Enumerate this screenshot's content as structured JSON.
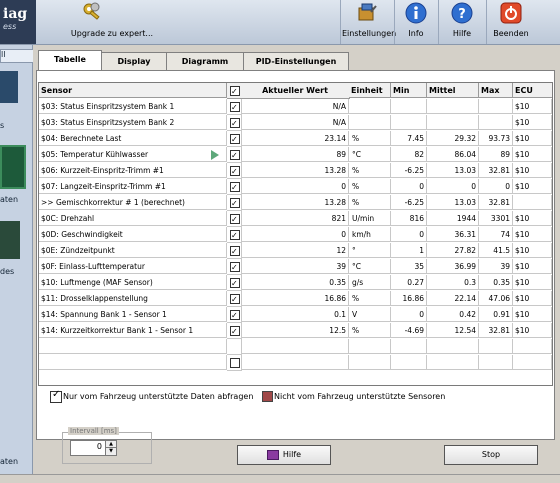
{
  "brand": {
    "title": "iag",
    "subtitle": "ess"
  },
  "toolbar": {
    "upgrade_label": "Upgrade zu expert...",
    "settings_label": "Einstellungen",
    "info_label": "Info",
    "help_label": "Hilfe",
    "exit_label": "Beenden"
  },
  "leftstrip": {
    "items": [
      "ll",
      "s",
      "aten",
      "des",
      "aten"
    ]
  },
  "tabs": [
    "Tabelle",
    "Display",
    "Diagramm",
    "PID-Einstellungen"
  ],
  "table": {
    "headers": {
      "sensor": "Sensor",
      "current": "Aktueller Wert",
      "unit": "Einheit",
      "min": "Min",
      "mean": "Mittel",
      "max": "Max",
      "ecu": "ECU"
    },
    "rows": [
      {
        "sensor": "$03: Status Einspritzsystem Bank 1",
        "value": "N/A",
        "unit": "",
        "min": "",
        "mean": "",
        "max": "",
        "ecu": "$10"
      },
      {
        "sensor": "$03: Status Einspritzsystem Bank 2",
        "value": "N/A",
        "unit": "",
        "min": "",
        "mean": "",
        "max": "",
        "ecu": "$10"
      },
      {
        "sensor": "$04: Berechnete Last",
        "value": "23.14",
        "unit": "%",
        "min": "7.45",
        "mean": "29.32",
        "max": "93.73",
        "ecu": "$10"
      },
      {
        "sensor": "$05: Temperatur Kühlwasser",
        "value": "89",
        "unit": "°C",
        "min": "82",
        "mean": "86.04",
        "max": "89",
        "ecu": "$10"
      },
      {
        "sensor": "$06: Kurzzeit-Einspritz-Trimm #1",
        "value": "13.28",
        "unit": "%",
        "min": "-6.25",
        "mean": "13.03",
        "max": "32.81",
        "ecu": "$10"
      },
      {
        "sensor": "$07: Langzeit-Einspritz-Trimm #1",
        "value": "0",
        "unit": "%",
        "min": "0",
        "mean": "0",
        "max": "0",
        "ecu": "$10"
      },
      {
        "sensor": ">> Gemischkorrektur # 1 (berechnet)",
        "value": "13.28",
        "unit": "%",
        "min": "-6.25",
        "mean": "13.03",
        "max": "32.81",
        "ecu": ""
      },
      {
        "sensor": "$0C: Drehzahl",
        "value": "821",
        "unit": "U/min",
        "min": "816",
        "mean": "1944",
        "max": "3301",
        "ecu": "$10"
      },
      {
        "sensor": "$0D: Geschwindigkeit",
        "value": "0",
        "unit": "km/h",
        "min": "0",
        "mean": "36.31",
        "max": "74",
        "ecu": "$10"
      },
      {
        "sensor": "$0E: Zündzeitpunkt",
        "value": "12",
        "unit": "°",
        "min": "1",
        "mean": "27.82",
        "max": "41.5",
        "ecu": "$10"
      },
      {
        "sensor": "$0F: Einlass-Lufttemperatur",
        "value": "39",
        "unit": "°C",
        "min": "35",
        "mean": "36.99",
        "max": "39",
        "ecu": "$10"
      },
      {
        "sensor": "$10: Luftmenge (MAF Sensor)",
        "value": "0.35",
        "unit": "g/s",
        "min": "0.27",
        "mean": "0.3",
        "max": "0.35",
        "ecu": "$10"
      },
      {
        "sensor": "$11: Drosselklappenstellung",
        "value": "16.86",
        "unit": "%",
        "min": "16.86",
        "mean": "22.14",
        "max": "47.06",
        "ecu": "$10"
      },
      {
        "sensor": "$14: Spannung Bank 1 - Sensor 1",
        "value": "0.1",
        "unit": "V",
        "min": "0",
        "mean": "0.42",
        "max": "0.91",
        "ecu": "$10"
      },
      {
        "sensor": "$14: Kurzzeitkorrektur Bank 1 - Sensor 1",
        "value": "12.5",
        "unit": "%",
        "min": "-4.69",
        "mean": "12.54",
        "max": "32.81",
        "ecu": "$10"
      }
    ]
  },
  "options": {
    "only_supported_label": "Nur vom Fahrzeug unterstützte Daten abfragen",
    "unsupported_legend": "Nicht vom Fahrzeug unterstützte Sensoren",
    "legend_color": "#a04848"
  },
  "interval": {
    "label": "Intervall [ms]",
    "value": "0"
  },
  "buttons": {
    "help": "Hilfe",
    "stop": "Stop"
  }
}
